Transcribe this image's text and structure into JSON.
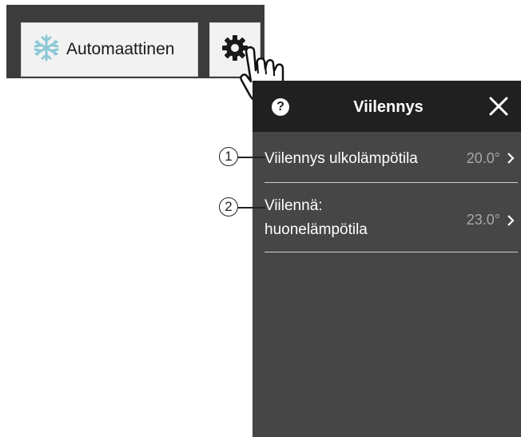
{
  "toolbar": {
    "mode_label": "Automaattinen",
    "mode_icon": "snowflake-icon",
    "settings_icon": "gear-icon"
  },
  "panel": {
    "title": "Viilennys",
    "help_icon_glyph": "?",
    "rows": [
      {
        "label": "Viilennys ulkolämpötila",
        "value": "20.0°"
      },
      {
        "label_line1": "Viilennä:",
        "label_line2": "huonelämpötila",
        "value": "23.0°"
      }
    ]
  },
  "callouts": [
    "1",
    "2"
  ],
  "colors": {
    "toolbar_bg": "#3c3c3c",
    "panel_bg": "#464646",
    "header_bg": "#202020",
    "accent_icon": "#8cc8d8"
  }
}
